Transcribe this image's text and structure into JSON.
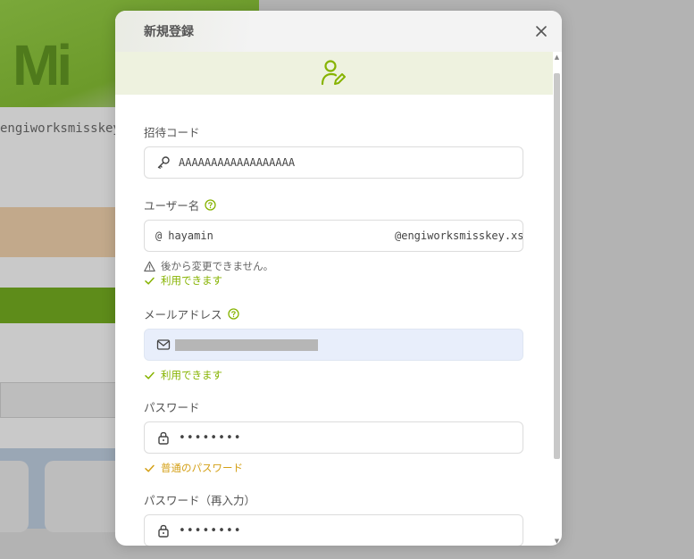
{
  "background": {
    "logo": "Mi",
    "url": "engiworksmisskey.xsr"
  },
  "modal": {
    "title": "新規登録"
  },
  "form": {
    "invite_code": {
      "label": "招待コード",
      "value": "AAAAAAAAAAAAAAAAAA"
    },
    "username": {
      "label": "ユーザー名",
      "prefix": "@",
      "value": "hayamin",
      "suffix": "@engiworksmisskey.xsr",
      "warning": "後から変更できません。",
      "status": "利用できます"
    },
    "email": {
      "label": "メールアドレス",
      "status": "利用できます"
    },
    "password": {
      "label": "パスワード",
      "value": "••••••••",
      "status": "普通のパスワード"
    },
    "password_retype": {
      "label": "パスワード（再入力）",
      "value": "••••••••"
    }
  },
  "colors": {
    "accent": "#86b300",
    "warning": "#d4a017",
    "banner": "#eef2df"
  }
}
